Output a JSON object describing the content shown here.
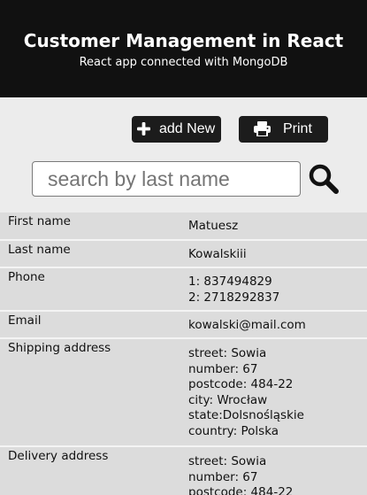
{
  "header": {
    "title": "Customer Management in React",
    "subtitle": "React app connected with MongoDB"
  },
  "toolbar": {
    "add_label": "add New",
    "print_label": "Print"
  },
  "search": {
    "placeholder": "search by last name",
    "value": ""
  },
  "customer": {
    "first_name_label": "First name",
    "first_name": "Matuesz",
    "last_name_label": "Last name",
    "last_name": "Kowalskiii",
    "phone_label": "Phone",
    "phone": "1: 837494829\n2: 2718292837",
    "email_label": "Email",
    "email": "kowalski@mail.com",
    "shipping_label": "Shipping address",
    "shipping": "street: Sowia\nnumber: 67\npostcode: 484-22\ncity:  Wrocław\nstate:Dolsnośląskie\ncountry: Polska",
    "delivery_label": "Delivery address",
    "delivery": "street: Sowia\nnumber: 67\npostcode: 484-22"
  },
  "icons": {
    "add": "plus-icon",
    "print": "printer-icon",
    "search": "magnifier-icon"
  },
  "colors": {
    "header_bg": "#111111",
    "button_bg": "#1c1c1c",
    "row_bg": "#dcdcdc",
    "page_bg": "#ececec"
  }
}
